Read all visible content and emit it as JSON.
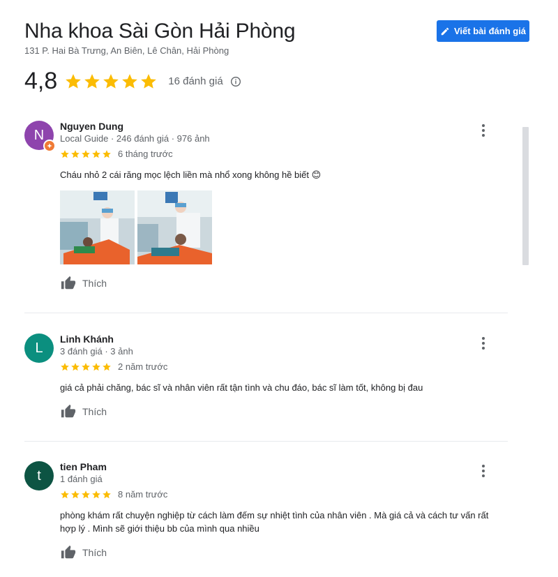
{
  "place": {
    "name": "Nha khoa Sài Gòn Hải Phòng",
    "address": "131 P. Hai Bà Trưng, An Biên, Lê Chân, Hải Phòng",
    "rating": "4,8",
    "stars": 5,
    "review_count": "16 đánh giá"
  },
  "write_button": {
    "label": "Viết bài đánh giá"
  },
  "colors": {
    "accent": "#1a73e8",
    "star": "#fbbc04"
  },
  "reviews": [
    {
      "initial": "N",
      "avatar_color": "#8e44ad",
      "name": "Nguyen Dung",
      "meta": "Local Guide · 246 đánh giá · 976 ảnh",
      "stars": 5,
      "time": "6 tháng trước",
      "text": "Cháu nhỏ 2 cái răng mọc lệch liền mà nhổ xong không hề biết 😊",
      "like": "Thích",
      "photos": 2
    },
    {
      "initial": "L",
      "avatar_color": "#0b8f7f",
      "name": "Linh Khánh",
      "meta": "3 đánh giá · 3 ảnh",
      "stars": 5,
      "time": "2 năm trước",
      "text": "giá cả phải chăng, bác sĩ và nhân viên rất tận tình và chu đáo, bác sĩ làm tốt, không bị đau",
      "like": "Thích"
    },
    {
      "initial": "t",
      "avatar_color": "#0d5443",
      "name": "tien Pham",
      "meta": "1 đánh giá",
      "stars": 5,
      "time": "8 năm trước",
      "text": "phòng khám rất chuyện nghiệp từ cách làm đếm sự nhiệt tình của nhân viên . Mà giá cả và cách tư vấn rất hợp lý . Mình sẽ giới thiệu bb của mình qua nhiều",
      "like": "Thích"
    }
  ]
}
